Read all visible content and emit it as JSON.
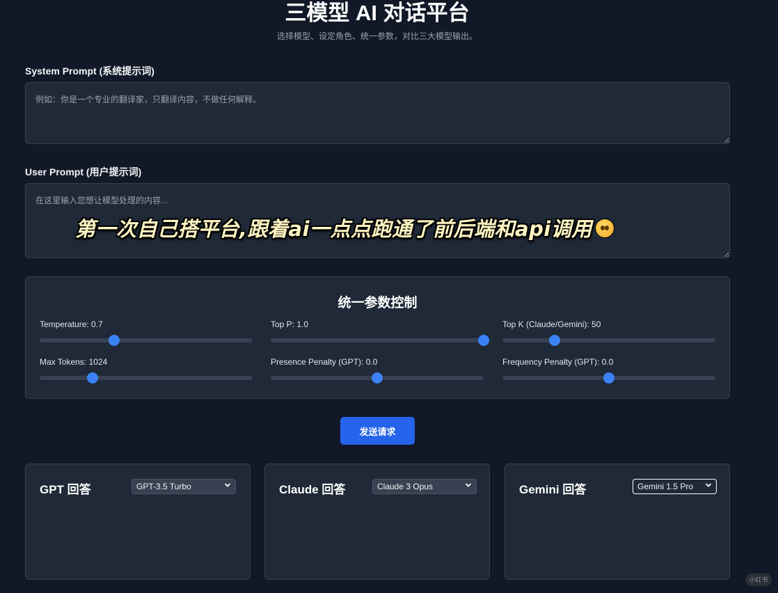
{
  "header": {
    "title": "三模型 AI 对话平台",
    "subtitle": "选择模型、设定角色、统一参数，对比三大模型输出。"
  },
  "system_prompt": {
    "label": "System Prompt (系统提示词)",
    "placeholder": "例如：你是一个专业的翻译家，只翻译内容，不做任何解释。",
    "value": ""
  },
  "user_prompt": {
    "label": "User Prompt (用户提示词)",
    "placeholder": "在这里输入您想让模型处理的内容...",
    "value": ""
  },
  "overlay_caption": "第一次自己搭平台,跟着ai一点点跑通了前后端和api调用",
  "params": {
    "title": "统一参数控制",
    "items": [
      {
        "label": "Temperature: 0.7",
        "value": 0.7,
        "min": 0,
        "max": 2
      },
      {
        "label": "Top P: 1.0",
        "value": 1.0,
        "min": 0,
        "max": 1
      },
      {
        "label": "Top K (Claude/Gemini): 50",
        "value": 50,
        "min": 1,
        "max": 200
      },
      {
        "label": "Max Tokens: 1024",
        "value": 1024,
        "min": 1,
        "max": 4096
      },
      {
        "label": "Presence Penalty (GPT): 0.0",
        "value": 0.0,
        "min": -2,
        "max": 2
      },
      {
        "label": "Frequency Penalty (GPT): 0.0",
        "value": 0.0,
        "min": -2,
        "max": 2
      }
    ]
  },
  "send_button": "发送请求",
  "panels": [
    {
      "title": "GPT 回答",
      "selected_model": "GPT-3.5 Turbo",
      "icon": "chevron-down-icon"
    },
    {
      "title": "Claude 回答",
      "selected_model": "Claude 3 Opus",
      "icon": "chevron-down-icon"
    },
    {
      "title": "Gemini 回答",
      "selected_model": "Gemini 1.5 Pro",
      "icon": "chevron-down-icon"
    }
  ],
  "watermark": "小红书",
  "colors": {
    "background": "#111827",
    "card": "#1f2937",
    "accent": "#3b82f6",
    "button": "#2563eb"
  }
}
